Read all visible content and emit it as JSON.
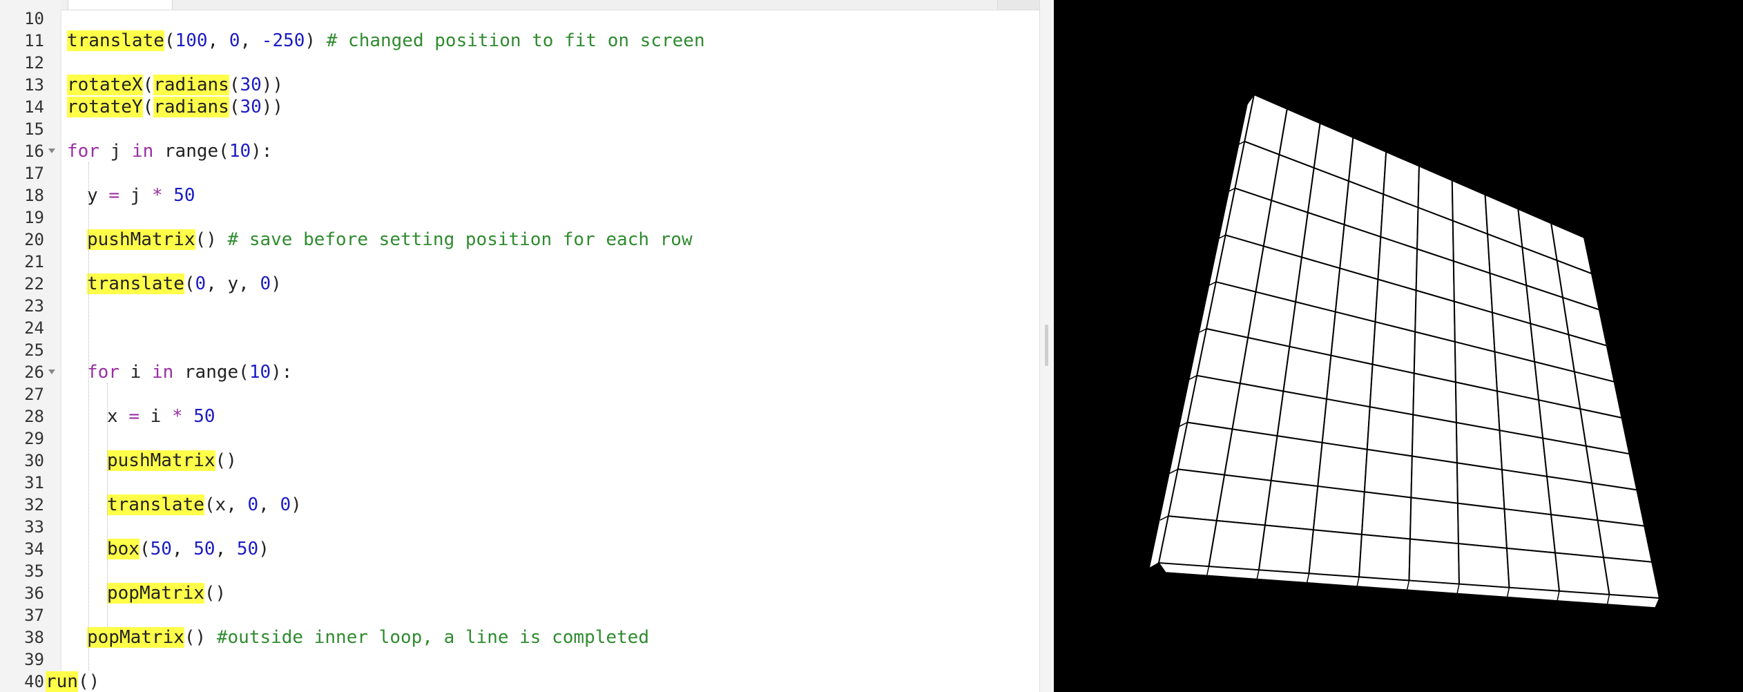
{
  "editor": {
    "lines": [
      {
        "n": "10",
        "fold": false,
        "indent": 0,
        "tokens": []
      },
      {
        "n": "11",
        "fold": false,
        "indent": 1,
        "tokens": [
          [
            "fn",
            "translate"
          ],
          [
            "p",
            "("
          ],
          [
            "num",
            "100"
          ],
          [
            "p",
            ", "
          ],
          [
            "num",
            "0"
          ],
          [
            "p",
            ", "
          ],
          [
            "num",
            "-250"
          ],
          [
            "p",
            ") "
          ],
          [
            "com",
            "# changed position to fit on screen"
          ]
        ]
      },
      {
        "n": "12",
        "fold": false,
        "indent": 0,
        "tokens": []
      },
      {
        "n": "13",
        "fold": false,
        "indent": 1,
        "tokens": [
          [
            "fn",
            "rotateX"
          ],
          [
            "p",
            "("
          ],
          [
            "fn",
            "radians"
          ],
          [
            "p",
            "("
          ],
          [
            "num",
            "30"
          ],
          [
            "p",
            "))"
          ]
        ]
      },
      {
        "n": "14",
        "fold": false,
        "indent": 1,
        "tokens": [
          [
            "fn",
            "rotateY"
          ],
          [
            "p",
            "("
          ],
          [
            "fn",
            "radians"
          ],
          [
            "p",
            "("
          ],
          [
            "num",
            "30"
          ],
          [
            "p",
            "))"
          ]
        ]
      },
      {
        "n": "15",
        "fold": false,
        "indent": 0,
        "tokens": []
      },
      {
        "n": "16",
        "fold": true,
        "indent": 1,
        "tokens": [
          [
            "kw",
            "for"
          ],
          [
            "p",
            " j "
          ],
          [
            "kw",
            "in"
          ],
          [
            "p",
            " range("
          ],
          [
            "num",
            "10"
          ],
          [
            "p",
            "):"
          ]
        ]
      },
      {
        "n": "17",
        "fold": false,
        "indent": 0,
        "tokens": []
      },
      {
        "n": "18",
        "fold": false,
        "indent": 2,
        "tokens": [
          [
            "p",
            "y "
          ],
          [
            "kw",
            "="
          ],
          [
            "p",
            " j "
          ],
          [
            "kw",
            "*"
          ],
          [
            "p",
            " "
          ],
          [
            "num",
            "50"
          ]
        ]
      },
      {
        "n": "19",
        "fold": false,
        "indent": 0,
        "tokens": []
      },
      {
        "n": "20",
        "fold": false,
        "indent": 2,
        "tokens": [
          [
            "fn",
            "pushMatrix"
          ],
          [
            "p",
            "() "
          ],
          [
            "com",
            "# save before setting position for each row"
          ]
        ]
      },
      {
        "n": "21",
        "fold": false,
        "indent": 0,
        "tokens": []
      },
      {
        "n": "22",
        "fold": false,
        "indent": 2,
        "tokens": [
          [
            "fn",
            "translate"
          ],
          [
            "p",
            "("
          ],
          [
            "num",
            "0"
          ],
          [
            "p",
            ", y, "
          ],
          [
            "num",
            "0"
          ],
          [
            "p",
            ")"
          ]
        ]
      },
      {
        "n": "23",
        "fold": false,
        "indent": 0,
        "tokens": []
      },
      {
        "n": "24",
        "fold": false,
        "indent": 0,
        "tokens": []
      },
      {
        "n": "25",
        "fold": false,
        "indent": 0,
        "tokens": []
      },
      {
        "n": "26",
        "fold": true,
        "indent": 2,
        "tokens": [
          [
            "kw",
            "for"
          ],
          [
            "p",
            " i "
          ],
          [
            "kw",
            "in"
          ],
          [
            "p",
            " range("
          ],
          [
            "num",
            "10"
          ],
          [
            "p",
            "):"
          ]
        ]
      },
      {
        "n": "27",
        "fold": false,
        "indent": 0,
        "tokens": []
      },
      {
        "n": "28",
        "fold": false,
        "indent": 3,
        "tokens": [
          [
            "p",
            "x "
          ],
          [
            "kw",
            "="
          ],
          [
            "p",
            " i "
          ],
          [
            "kw",
            "*"
          ],
          [
            "p",
            " "
          ],
          [
            "num",
            "50"
          ]
        ]
      },
      {
        "n": "29",
        "fold": false,
        "indent": 0,
        "tokens": []
      },
      {
        "n": "30",
        "fold": false,
        "indent": 3,
        "tokens": [
          [
            "fn",
            "pushMatrix"
          ],
          [
            "p",
            "()"
          ]
        ]
      },
      {
        "n": "31",
        "fold": false,
        "indent": 0,
        "tokens": []
      },
      {
        "n": "32",
        "fold": false,
        "indent": 3,
        "tokens": [
          [
            "fn",
            "translate"
          ],
          [
            "p",
            "(x, "
          ],
          [
            "num",
            "0"
          ],
          [
            "p",
            ", "
          ],
          [
            "num",
            "0"
          ],
          [
            "p",
            ")"
          ]
        ]
      },
      {
        "n": "33",
        "fold": false,
        "indent": 0,
        "tokens": []
      },
      {
        "n": "34",
        "fold": false,
        "indent": 3,
        "tokens": [
          [
            "fn",
            "box"
          ],
          [
            "p",
            "("
          ],
          [
            "num",
            "50"
          ],
          [
            "p",
            ", "
          ],
          [
            "num",
            "50"
          ],
          [
            "p",
            ", "
          ],
          [
            "num",
            "50"
          ],
          [
            "p",
            ")"
          ]
        ]
      },
      {
        "n": "35",
        "fold": false,
        "indent": 0,
        "tokens": []
      },
      {
        "n": "36",
        "fold": false,
        "indent": 3,
        "tokens": [
          [
            "fn",
            "popMatrix"
          ],
          [
            "p",
            "()"
          ]
        ]
      },
      {
        "n": "37",
        "fold": false,
        "indent": 0,
        "tokens": []
      },
      {
        "n": "38",
        "fold": false,
        "indent": 2,
        "tokens": [
          [
            "fn",
            "popMatrix"
          ],
          [
            "p",
            "() "
          ],
          [
            "com",
            "#outside inner loop, a line is completed"
          ]
        ]
      },
      {
        "n": "39",
        "fold": false,
        "indent": 0,
        "tokens": []
      },
      {
        "n": "40",
        "fold": false,
        "indent": 0,
        "tokens": [
          [
            "fn",
            "run"
          ],
          [
            "p",
            "()"
          ]
        ]
      }
    ]
  },
  "sketch": {
    "grid_rows": 10,
    "grid_cols": 10,
    "background_color": "#000000",
    "face_color": "#ffffff",
    "edge_color": "#000000"
  },
  "colors": {
    "keyword": "#9a2fa3",
    "number": "#1b1bc4",
    "comment": "#2f8b2f",
    "function_highlight": "#ffff4a"
  }
}
